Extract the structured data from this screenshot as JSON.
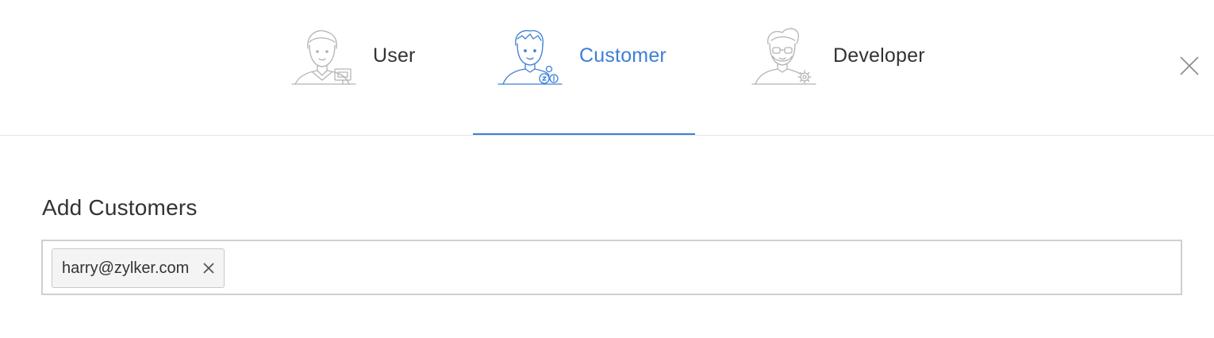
{
  "tabs": [
    {
      "label": "User",
      "avatar": "user-avatar-icon",
      "active": false
    },
    {
      "label": "Customer",
      "avatar": "customer-avatar-icon",
      "active": true
    },
    {
      "label": "Developer",
      "avatar": "developer-avatar-icon",
      "active": false
    }
  ],
  "close_icon": "close-icon",
  "form": {
    "title": "Add Customers",
    "tags": [
      {
        "text": "harry@zylker.com",
        "remove_icon": "close-icon"
      }
    ],
    "input_value": ""
  },
  "colors": {
    "accent": "#3c7fd6",
    "text": "#333333",
    "border": "#cfcfcf",
    "avatar_stroke": "#b3b3b3"
  }
}
